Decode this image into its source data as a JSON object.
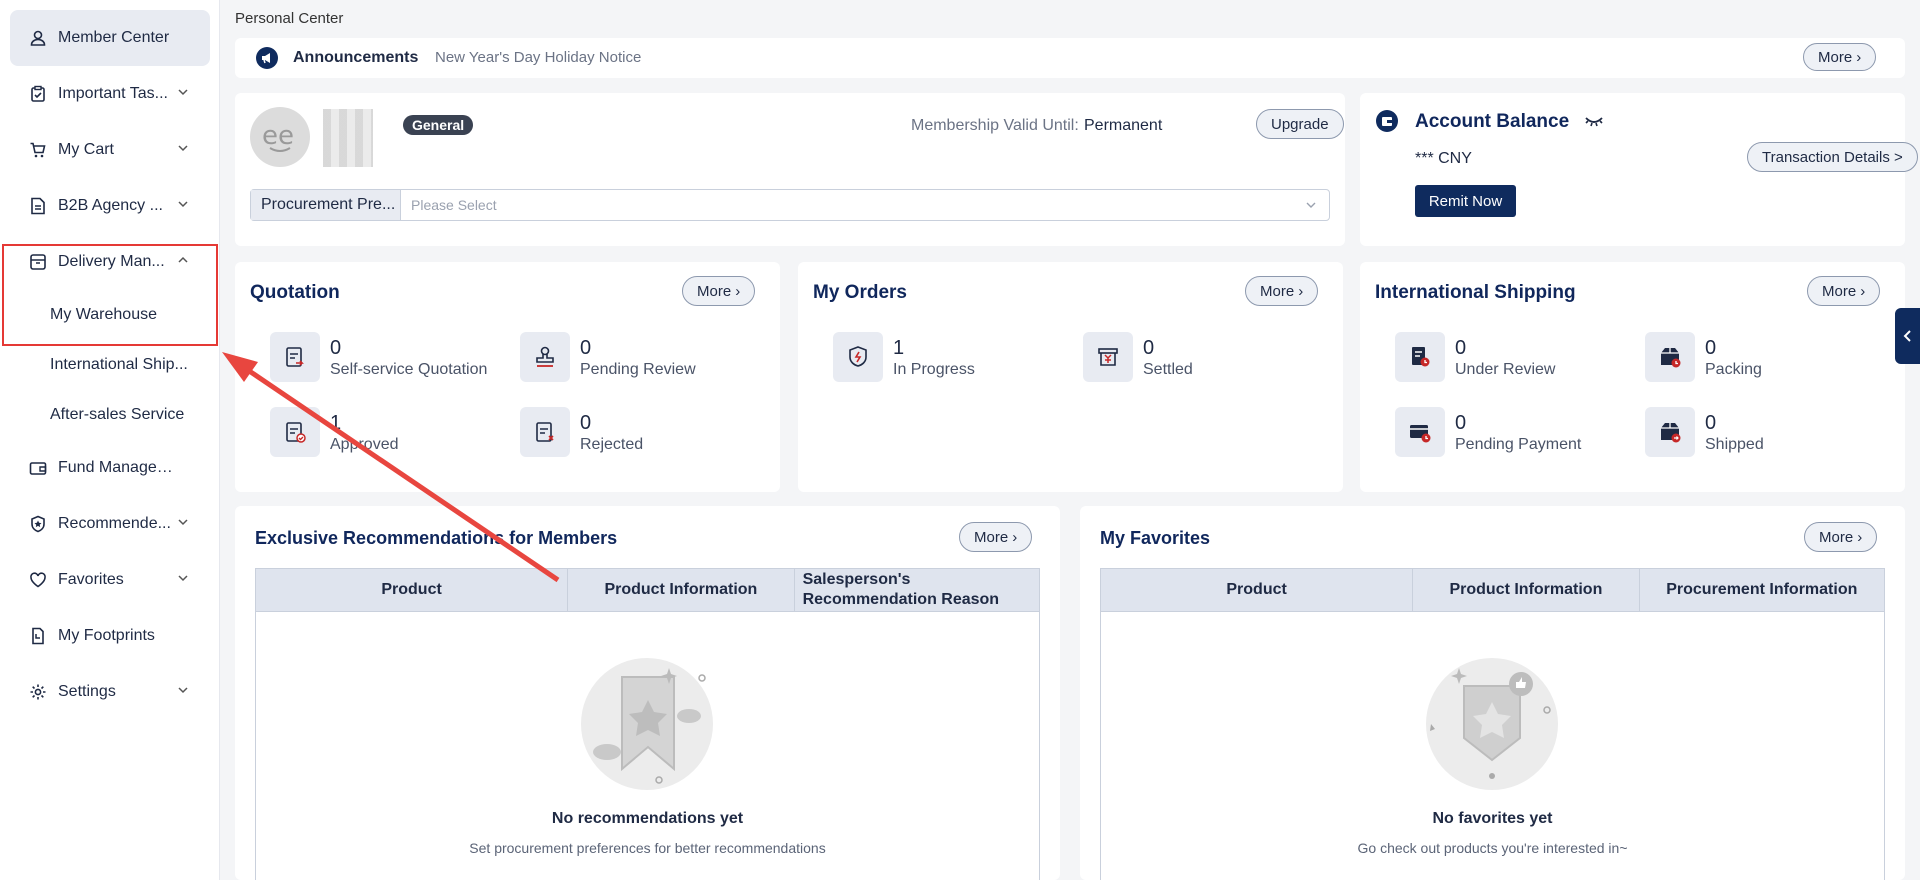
{
  "sidebar": {
    "items": [
      {
        "label": "Member Center",
        "icon": "user-icon"
      },
      {
        "label": "Important Tas...",
        "icon": "clipboard-check-icon"
      },
      {
        "label": "My Cart",
        "icon": "cart-icon"
      },
      {
        "label": "B2B Agency ...",
        "icon": "document-icon"
      },
      {
        "label": "Delivery Man...",
        "icon": "box-icon"
      },
      {
        "label": "Fund Management",
        "icon": "wallet-icon"
      },
      {
        "label": "Recommende...",
        "icon": "badge-star-icon"
      },
      {
        "label": "Favorites",
        "icon": "heart-icon"
      },
      {
        "label": "My Footprints",
        "icon": "footprint-icon"
      },
      {
        "label": "Settings",
        "icon": "gear-icon"
      }
    ],
    "sub_items": [
      "My Warehouse",
      "International Ship...",
      "After-sales Service"
    ]
  },
  "breadcrumb": "Personal Center",
  "announcements": {
    "title": "Announcements",
    "notice": "New Year's Day Holiday Notice",
    "more": "More"
  },
  "profile": {
    "level": "General",
    "valid_label": "Membership Valid Until:",
    "valid_value": "Permanent",
    "upgrade": "Upgrade",
    "pref_label": "Procurement Pre...",
    "pref_placeholder": "Please Select"
  },
  "balance": {
    "title": "Account Balance",
    "amount": "*** CNY",
    "details": "Transaction Details >",
    "remit": "Remit Now"
  },
  "quotation": {
    "title": "Quotation",
    "more": "More",
    "stats": [
      {
        "value": "0",
        "label": "Self-service Quotation"
      },
      {
        "value": "0",
        "label": "Pending Review"
      },
      {
        "value": "1",
        "label": "Approved"
      },
      {
        "value": "0",
        "label": "Rejected"
      }
    ]
  },
  "orders": {
    "title": "My Orders",
    "more": "More",
    "stats": [
      {
        "value": "1",
        "label": "In Progress"
      },
      {
        "value": "0",
        "label": "Settled"
      }
    ]
  },
  "shipping": {
    "title": "International Shipping",
    "more": "More",
    "stats": [
      {
        "value": "0",
        "label": "Under Review"
      },
      {
        "value": "0",
        "label": "Packing"
      },
      {
        "value": "0",
        "label": "Pending Payment"
      },
      {
        "value": "0",
        "label": "Shipped"
      }
    ]
  },
  "recommendations": {
    "title": "Exclusive Recommendations for Members",
    "more": "More",
    "columns": [
      "Product",
      "Product Information",
      "Salesperson's Recommendation Reason"
    ],
    "empty_title": "No recommendations yet",
    "empty_sub": "Set procurement preferences for better recommendations"
  },
  "favorites": {
    "title": "My Favorites",
    "more": "More",
    "columns": [
      "Product",
      "Product Information",
      "Procurement Information"
    ],
    "empty_title": "No favorites yet",
    "empty_sub": "Go check out products you're interested in~"
  },
  "colors": {
    "accent": "#0f2b5e",
    "highlight": "#e53935",
    "badge": "#3a4252"
  }
}
